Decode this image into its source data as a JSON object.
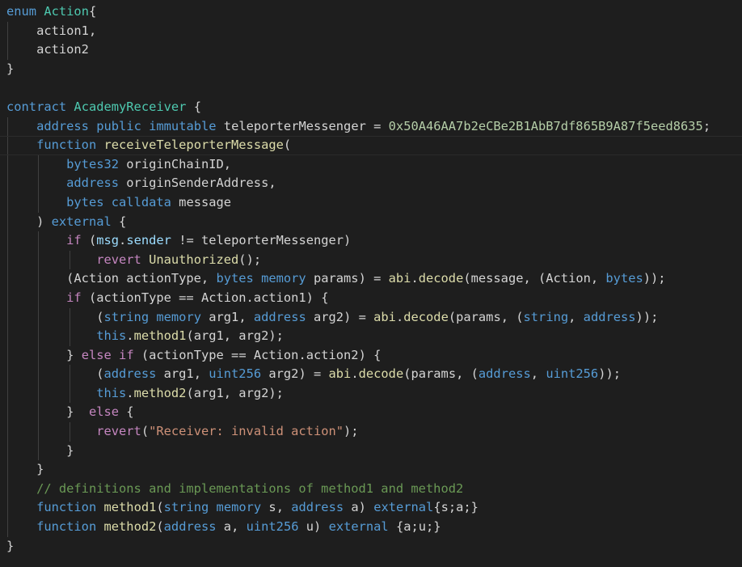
{
  "editor": {
    "language": "solidity",
    "colors": {
      "background": "#1e1e1e",
      "text": "#d4d4d4",
      "keyword": "#569cd6",
      "control": "#c586c0",
      "type": "#4ec9b0",
      "function": "#dcdcaa",
      "variable": "#9cdcfe",
      "number": "#b5cea8",
      "string": "#ce9178",
      "comment": "#6a9955"
    },
    "lines": [
      {
        "depth": 0,
        "tokens": [
          [
            "keyword",
            "enum"
          ],
          [
            "text",
            " "
          ],
          [
            "type",
            "Action"
          ],
          [
            "text",
            "{"
          ]
        ]
      },
      {
        "depth": 1,
        "tokens": [
          [
            "text",
            "action1,"
          ]
        ]
      },
      {
        "depth": 1,
        "tokens": [
          [
            "text",
            "action2"
          ]
        ]
      },
      {
        "depth": 0,
        "tokens": [
          [
            "text",
            "}"
          ]
        ]
      },
      {
        "depth": 0,
        "tokens": []
      },
      {
        "depth": 0,
        "tokens": [
          [
            "keyword",
            "contract"
          ],
          [
            "text",
            " "
          ],
          [
            "type",
            "AcademyReceiver"
          ],
          [
            "text",
            " {"
          ]
        ]
      },
      {
        "depth": 1,
        "tokens": [
          [
            "keyword",
            "address"
          ],
          [
            "text",
            " "
          ],
          [
            "keyword",
            "public"
          ],
          [
            "text",
            " "
          ],
          [
            "keyword",
            "immutable"
          ],
          [
            "text",
            " teleporterMessenger = "
          ],
          [
            "number",
            "0x50A46AA7b2eCBe2B1AbB7df865B9A87f5eed8635"
          ],
          [
            "text",
            ";"
          ]
        ]
      },
      {
        "depth": 1,
        "current": true,
        "tokens": [
          [
            "keyword",
            "function"
          ],
          [
            "text",
            " "
          ],
          [
            "func",
            "receiveTeleporterMessage"
          ],
          [
            "text",
            "("
          ]
        ]
      },
      {
        "depth": 2,
        "tokens": [
          [
            "keyword",
            "bytes32"
          ],
          [
            "text",
            " originChainID,"
          ]
        ]
      },
      {
        "depth": 2,
        "tokens": [
          [
            "keyword",
            "address"
          ],
          [
            "text",
            " originSenderAddress,"
          ]
        ]
      },
      {
        "depth": 2,
        "tokens": [
          [
            "keyword",
            "bytes"
          ],
          [
            "text",
            " "
          ],
          [
            "keyword",
            "calldata"
          ],
          [
            "text",
            " message"
          ]
        ]
      },
      {
        "depth": 1,
        "tokens": [
          [
            "text",
            ") "
          ],
          [
            "keyword",
            "external"
          ],
          [
            "text",
            " {"
          ]
        ]
      },
      {
        "depth": 2,
        "tokens": [
          [
            "control",
            "if"
          ],
          [
            "text",
            " ("
          ],
          [
            "var",
            "msg"
          ],
          [
            "text",
            "."
          ],
          [
            "var",
            "sender"
          ],
          [
            "text",
            " != teleporterMessenger)"
          ]
        ]
      },
      {
        "depth": 3,
        "tokens": [
          [
            "control",
            "revert"
          ],
          [
            "text",
            " "
          ],
          [
            "func",
            "Unauthorized"
          ],
          [
            "text",
            "();"
          ]
        ]
      },
      {
        "depth": 2,
        "tokens": [
          [
            "text",
            "(Action actionType, "
          ],
          [
            "keyword",
            "bytes"
          ],
          [
            "text",
            " "
          ],
          [
            "keyword",
            "memory"
          ],
          [
            "text",
            " params) = "
          ],
          [
            "func",
            "abi"
          ],
          [
            "text",
            "."
          ],
          [
            "func",
            "decode"
          ],
          [
            "text",
            "(message, (Action, "
          ],
          [
            "keyword",
            "bytes"
          ],
          [
            "text",
            "));"
          ]
        ]
      },
      {
        "depth": 2,
        "tokens": [
          [
            "control",
            "if"
          ],
          [
            "text",
            " (actionType == Action.action1) {"
          ]
        ]
      },
      {
        "depth": 3,
        "tokens": [
          [
            "text",
            "("
          ],
          [
            "keyword",
            "string"
          ],
          [
            "text",
            " "
          ],
          [
            "keyword",
            "memory"
          ],
          [
            "text",
            " arg1, "
          ],
          [
            "keyword",
            "address"
          ],
          [
            "text",
            " arg2) = "
          ],
          [
            "func",
            "abi"
          ],
          [
            "text",
            "."
          ],
          [
            "func",
            "decode"
          ],
          [
            "text",
            "(params, ("
          ],
          [
            "keyword",
            "string"
          ],
          [
            "text",
            ", "
          ],
          [
            "keyword",
            "address"
          ],
          [
            "text",
            "));"
          ]
        ]
      },
      {
        "depth": 3,
        "tokens": [
          [
            "keyword",
            "this"
          ],
          [
            "text",
            "."
          ],
          [
            "func",
            "method1"
          ],
          [
            "text",
            "(arg1, arg2);"
          ]
        ]
      },
      {
        "depth": 2,
        "tokens": [
          [
            "text",
            "} "
          ],
          [
            "control",
            "else"
          ],
          [
            "text",
            " "
          ],
          [
            "control",
            "if"
          ],
          [
            "text",
            " (actionType == Action.action2) {"
          ]
        ]
      },
      {
        "depth": 3,
        "tokens": [
          [
            "text",
            "("
          ],
          [
            "keyword",
            "address"
          ],
          [
            "text",
            " arg1, "
          ],
          [
            "keyword",
            "uint256"
          ],
          [
            "text",
            " arg2) = "
          ],
          [
            "func",
            "abi"
          ],
          [
            "text",
            "."
          ],
          [
            "func",
            "decode"
          ],
          [
            "text",
            "(params, ("
          ],
          [
            "keyword",
            "address"
          ],
          [
            "text",
            ", "
          ],
          [
            "keyword",
            "uint256"
          ],
          [
            "text",
            "));"
          ]
        ]
      },
      {
        "depth": 3,
        "tokens": [
          [
            "keyword",
            "this"
          ],
          [
            "text",
            "."
          ],
          [
            "func",
            "method2"
          ],
          [
            "text",
            "(arg1, arg2);"
          ]
        ]
      },
      {
        "depth": 2,
        "tokens": [
          [
            "text",
            "}  "
          ],
          [
            "control",
            "else"
          ],
          [
            "text",
            " {"
          ]
        ]
      },
      {
        "depth": 3,
        "tokens": [
          [
            "control",
            "revert"
          ],
          [
            "text",
            "("
          ],
          [
            "string",
            "\"Receiver: invalid action\""
          ],
          [
            "text",
            ");"
          ]
        ]
      },
      {
        "depth": 2,
        "tokens": [
          [
            "text",
            "}"
          ]
        ]
      },
      {
        "depth": 1,
        "tokens": [
          [
            "text",
            "}"
          ]
        ]
      },
      {
        "depth": 1,
        "tokens": [
          [
            "comment",
            "// definitions and implementations of method1 and method2"
          ]
        ]
      },
      {
        "depth": 1,
        "tokens": [
          [
            "keyword",
            "function"
          ],
          [
            "text",
            " "
          ],
          [
            "func",
            "method1"
          ],
          [
            "text",
            "("
          ],
          [
            "keyword",
            "string"
          ],
          [
            "text",
            " "
          ],
          [
            "keyword",
            "memory"
          ],
          [
            "text",
            " s, "
          ],
          [
            "keyword",
            "address"
          ],
          [
            "text",
            " a) "
          ],
          [
            "keyword",
            "external"
          ],
          [
            "text",
            "{s;a;}"
          ]
        ]
      },
      {
        "depth": 1,
        "tokens": [
          [
            "keyword",
            "function"
          ],
          [
            "text",
            " "
          ],
          [
            "func",
            "method2"
          ],
          [
            "text",
            "("
          ],
          [
            "keyword",
            "address"
          ],
          [
            "text",
            " a, "
          ],
          [
            "keyword",
            "uint256"
          ],
          [
            "text",
            " u) "
          ],
          [
            "keyword",
            "external"
          ],
          [
            "text",
            " {a;u;}"
          ]
        ]
      },
      {
        "depth": 0,
        "tokens": [
          [
            "text",
            "}"
          ]
        ]
      }
    ]
  }
}
